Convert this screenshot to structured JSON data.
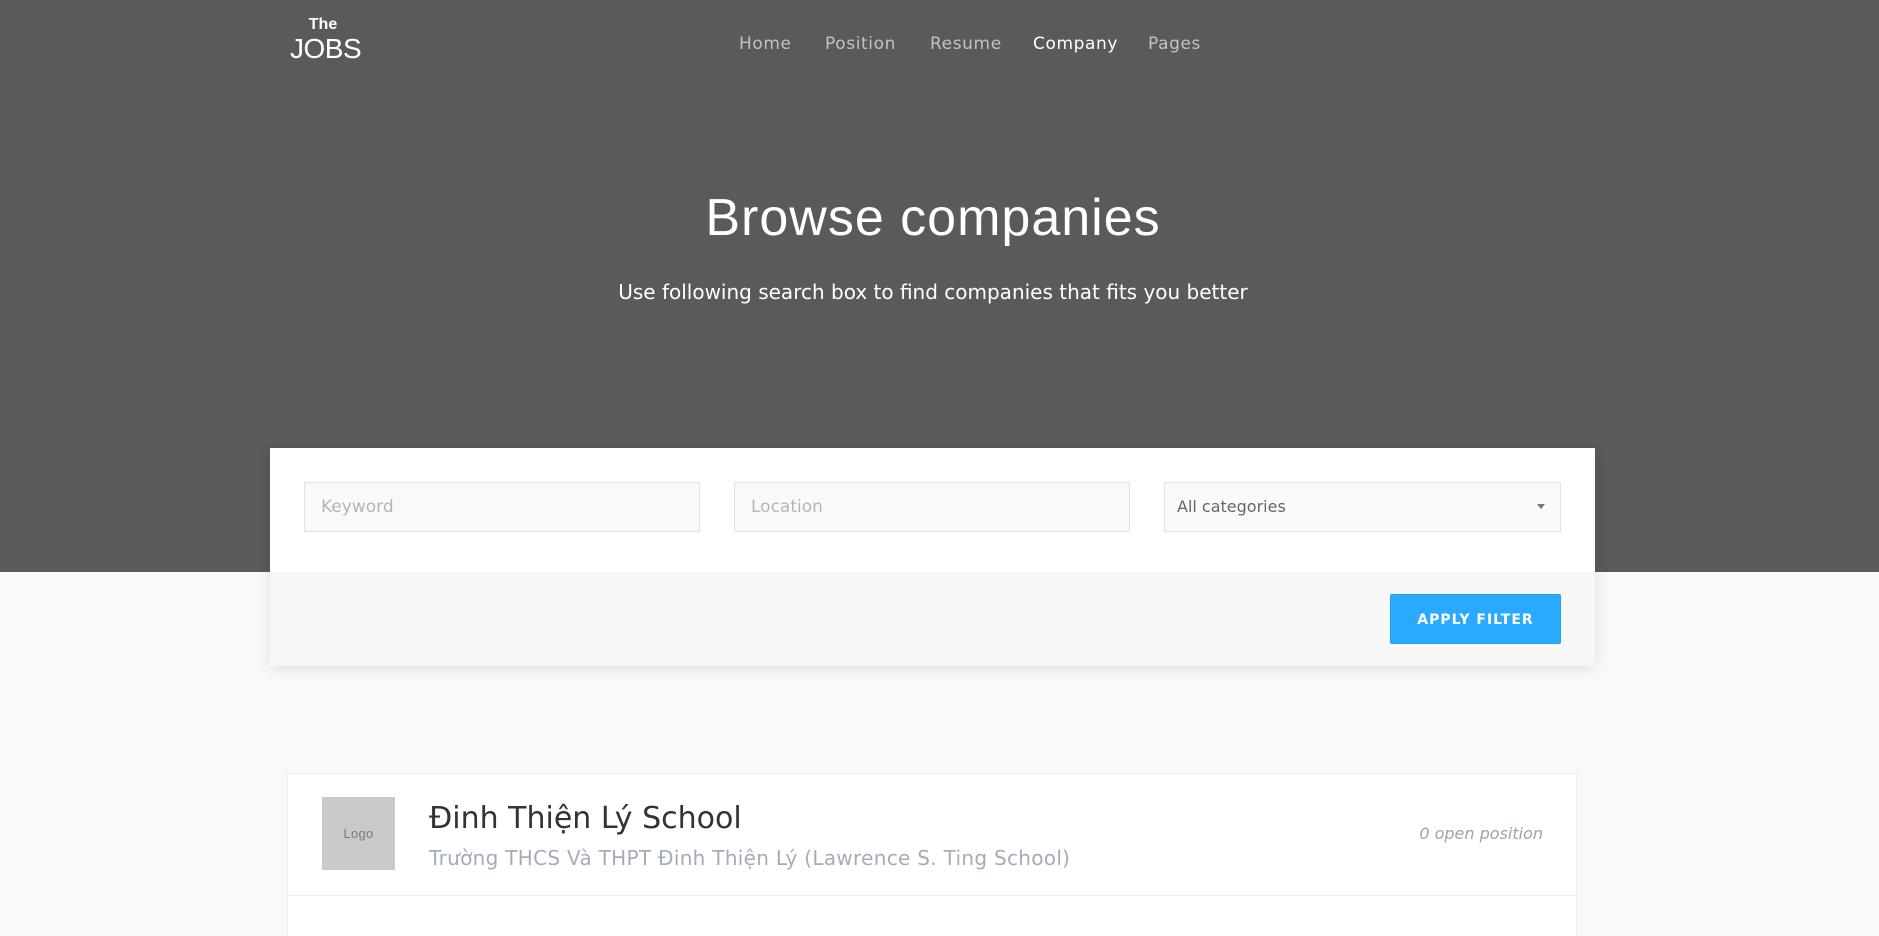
{
  "header": {
    "logo": {
      "line1": "The",
      "line2": "JOBS"
    },
    "nav": [
      {
        "label": "Home",
        "active": false
      },
      {
        "label": "Position",
        "active": false
      },
      {
        "label": "Resume",
        "active": false
      },
      {
        "label": "Company",
        "active": true
      },
      {
        "label": "Pages",
        "active": false
      }
    ]
  },
  "hero": {
    "title": "Browse companies",
    "subtitle": "Use following search box to find companies that fits you better"
  },
  "filter": {
    "keyword_placeholder": "Keyword",
    "location_placeholder": "Location",
    "category_value": "All categories",
    "apply_label": "APPLY FILTER"
  },
  "companies": [
    {
      "logo_text": "Logo",
      "name": "Đinh Thiện Lý School",
      "description": "Trường THCS Và THPT Đinh Thiện Lý (Lawrence S. Ting School)",
      "open_positions": "0 open position"
    }
  ],
  "colors": {
    "hero_bg": "#5a5a5a",
    "accent": "#29aafe",
    "page_bg": "#f9f9f9"
  }
}
